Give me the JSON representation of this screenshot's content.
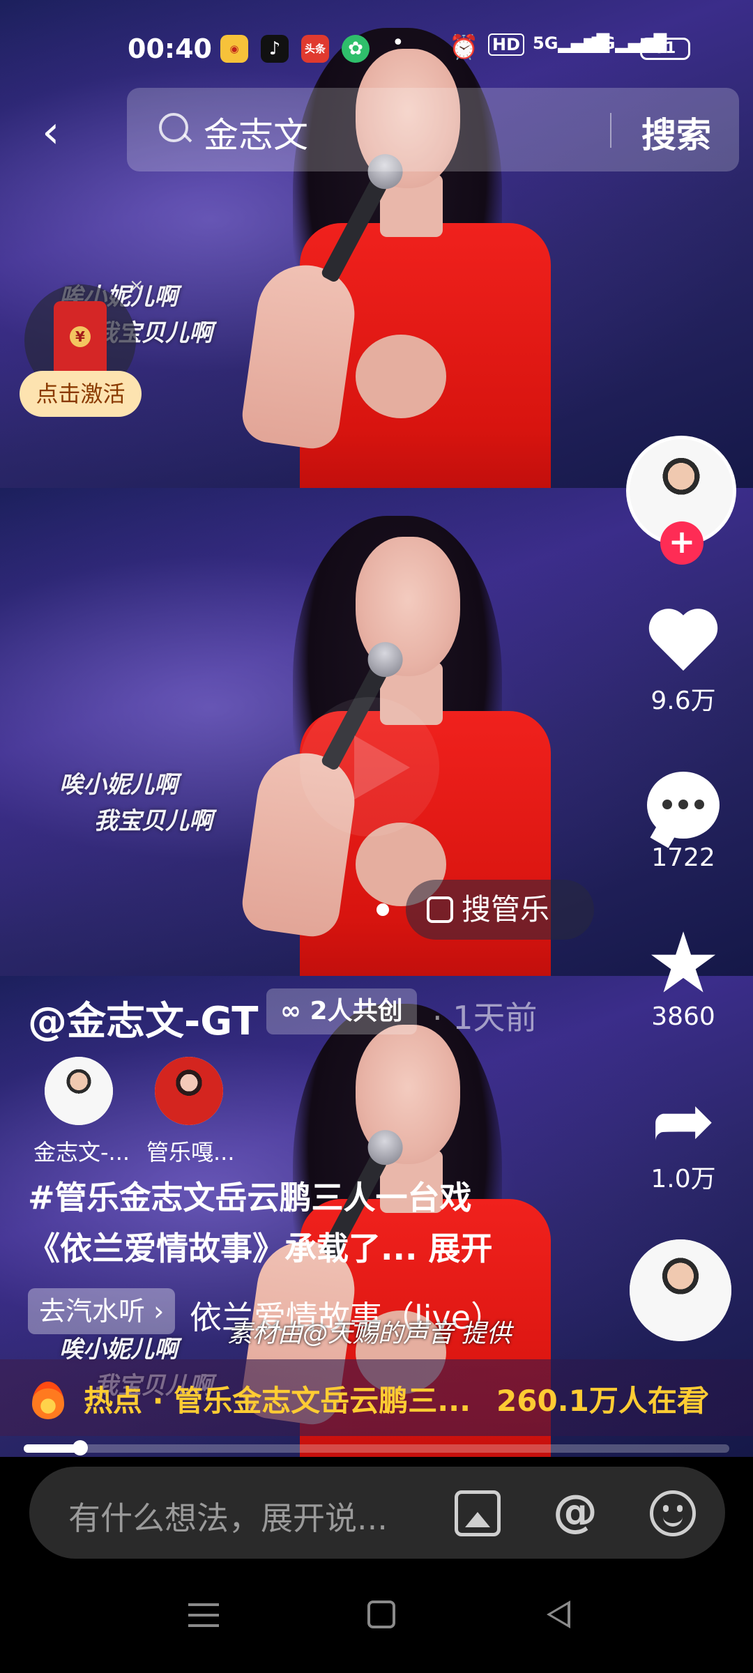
{
  "status_bar": {
    "time": "00:40",
    "app_icons": [
      "weibo-icon",
      "tiktok-icon",
      "toutiao-icon",
      "green-app-icon"
    ],
    "toutiao_label": "头条",
    "hd_label": "HD",
    "signal1": "5G",
    "signal2": "5G",
    "battery": "51"
  },
  "search": {
    "query": "金志文",
    "button": "搜索"
  },
  "red_envelope": {
    "label": "点击激活",
    "close": "×"
  },
  "lyrics": {
    "line1": "唉小妮儿啊",
    "line2": "我宝贝儿啊"
  },
  "actions": {
    "likes": "9.6万",
    "comments": "1722",
    "favorites": "3860",
    "shares": "1.0万"
  },
  "search_pill": "搜管乐",
  "creator": {
    "handle": "@金志文-GT",
    "cocreate": "2人共创",
    "time_ago": "· 1天前",
    "collaborators": [
      {
        "name": "金志文-..."
      },
      {
        "name": "管乐嘎..."
      }
    ]
  },
  "description": {
    "line1": "#管乐金志文岳云鹏三人一台戏",
    "line2": "《依兰爱情故事》承载了... 展开"
  },
  "music": {
    "soda_label": "去汽水听 ›",
    "song": "依兰爱情故事（live）",
    "credit": "素材由@天赐的声音 提供"
  },
  "hot": {
    "topic": "热点 · 管乐金志文岳云鹏三...",
    "viewers": "260.1万人在看",
    "chevron": "›"
  },
  "progress": 0.08,
  "comment": {
    "placeholder": "有什么想法，展开说..."
  }
}
